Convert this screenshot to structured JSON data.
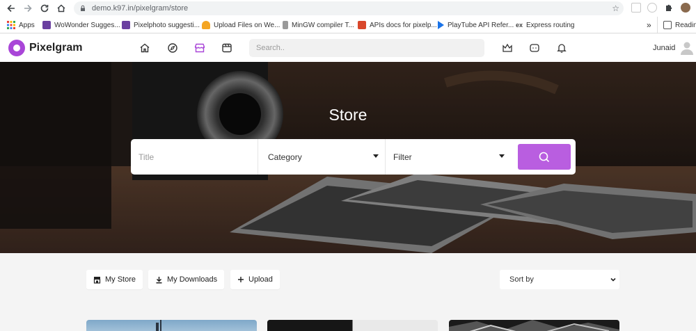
{
  "browser": {
    "url": "demo.k97.in/pixelgram/store",
    "bookmarks": [
      {
        "label": "Apps",
        "color": "#e8453c"
      },
      {
        "label": "WoWonder Sugges...",
        "color": "#6a3fa0"
      },
      {
        "label": "Pixelphoto suggesti...",
        "color": "#6a3fa0"
      },
      {
        "label": "Upload Files on We...",
        "color": "#f4a522"
      },
      {
        "label": "MinGW compiler T...",
        "color": "#7a7a7a"
      },
      {
        "label": "APIs docs for pixelp...",
        "color": "#d9472b"
      },
      {
        "label": "PlayTube API Refer...",
        "color": "#1a73e8"
      },
      {
        "label": "Express routing",
        "color": "#444444"
      },
      {
        "label": "Reading list",
        "color": "#444444"
      }
    ],
    "bookmarks_overflow": "»"
  },
  "header": {
    "logo_text": "Pixelgram",
    "search_placeholder": "Search..",
    "username": "Junaid",
    "accent_color": "#a946d8"
  },
  "hero": {
    "title": "Store",
    "title_placeholder": "Title",
    "category_label": "Category",
    "filter_label": "Filter"
  },
  "toolbar": {
    "my_store": "My Store",
    "my_downloads": "My Downloads",
    "upload": "Upload",
    "sort_by": "Sort by"
  }
}
